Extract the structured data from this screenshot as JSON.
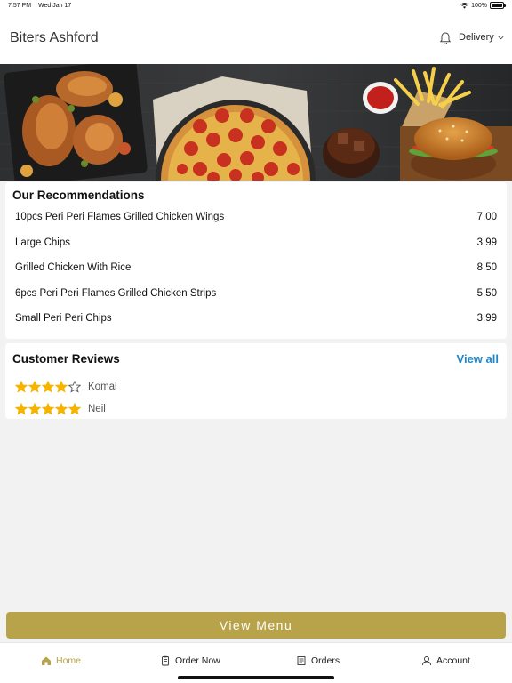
{
  "status_bar": {
    "time": "7:57 PM",
    "date": "Wed Jan 17",
    "battery": "100%"
  },
  "header": {
    "restaurant_name": "Biters Ashford",
    "order_mode": "Delivery"
  },
  "recommendations": {
    "title": "Our Recommendations",
    "items": [
      {
        "name": "10pcs Peri Peri Flames Grilled Chicken Wings",
        "price": "7.00"
      },
      {
        "name": "Large Chips",
        "price": "3.99"
      },
      {
        "name": "Grilled Chicken With Rice",
        "price": "8.50"
      },
      {
        "name": "6pcs Peri Peri Flames Grilled Chicken Strips",
        "price": "5.50"
      },
      {
        "name": "Small Peri Peri Chips",
        "price": "3.99"
      }
    ]
  },
  "reviews": {
    "title": "Customer Reviews",
    "view_all": "View all",
    "items": [
      {
        "reviewer": "Komal",
        "rating": 4
      },
      {
        "reviewer": "Neil",
        "rating": 5
      }
    ]
  },
  "view_menu_label": "View Menu",
  "tabs": [
    {
      "label": "Home",
      "icon": "home-icon",
      "active": true
    },
    {
      "label": "Order Now",
      "icon": "order-icon",
      "active": false
    },
    {
      "label": "Orders",
      "icon": "receipt-icon",
      "active": false
    },
    {
      "label": "Account",
      "icon": "user-icon",
      "active": false
    }
  ],
  "colors": {
    "accent": "#b8a34b",
    "link": "#1e88c9",
    "star": "#f5b400"
  }
}
